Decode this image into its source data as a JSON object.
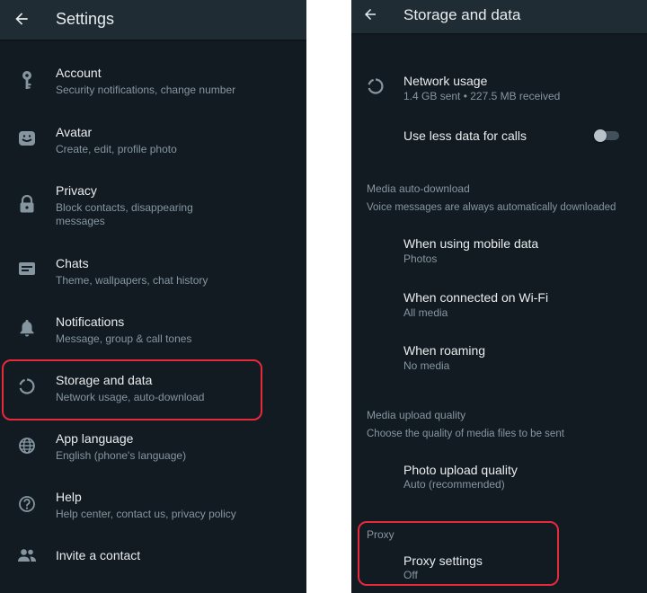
{
  "left": {
    "title": "Settings",
    "items": [
      {
        "title": "Account",
        "subtitle": "Security notifications, change number"
      },
      {
        "title": "Avatar",
        "subtitle": "Create, edit, profile photo"
      },
      {
        "title": "Privacy",
        "subtitle_line1": "Block contacts, disappearing",
        "subtitle_line2": "messages"
      },
      {
        "title": "Chats",
        "subtitle": "Theme, wallpapers, chat history"
      },
      {
        "title": "Notifications",
        "subtitle": "Message, group & call tones"
      },
      {
        "title": "Storage and data",
        "subtitle": "Network usage, auto-download"
      },
      {
        "title": "App language",
        "subtitle": "English (phone's language)"
      },
      {
        "title": "Help",
        "subtitle": "Help center, contact us, privacy policy"
      },
      {
        "title": "Invite a contact"
      }
    ]
  },
  "right": {
    "title": "Storage and data",
    "network_usage": {
      "title": "Network usage",
      "subtitle": "1.4 GB sent • 227.5 MB received"
    },
    "less_data": {
      "title": "Use less data for calls",
      "enabled": false
    },
    "media_auto_download": {
      "header": "Media auto-download",
      "note": "Voice messages are always automatically downloaded",
      "items": [
        {
          "title": "When using mobile data",
          "subtitle": "Photos"
        },
        {
          "title": "When connected on Wi-Fi",
          "subtitle": "All media"
        },
        {
          "title": "When roaming",
          "subtitle": "No media"
        }
      ]
    },
    "media_upload_quality": {
      "header": "Media upload quality",
      "note": "Choose the quality of media files to be sent",
      "photo": {
        "title": "Photo upload quality",
        "subtitle": "Auto (recommended)"
      }
    },
    "proxy": {
      "header": "Proxy",
      "settings": {
        "title": "Proxy settings",
        "subtitle": "Off"
      }
    }
  },
  "colors": {
    "background": "#121b22",
    "appbar": "#1f2c34",
    "primary_text": "#e9edef",
    "secondary_text": "#8696a0",
    "highlight": "#e8283b"
  }
}
